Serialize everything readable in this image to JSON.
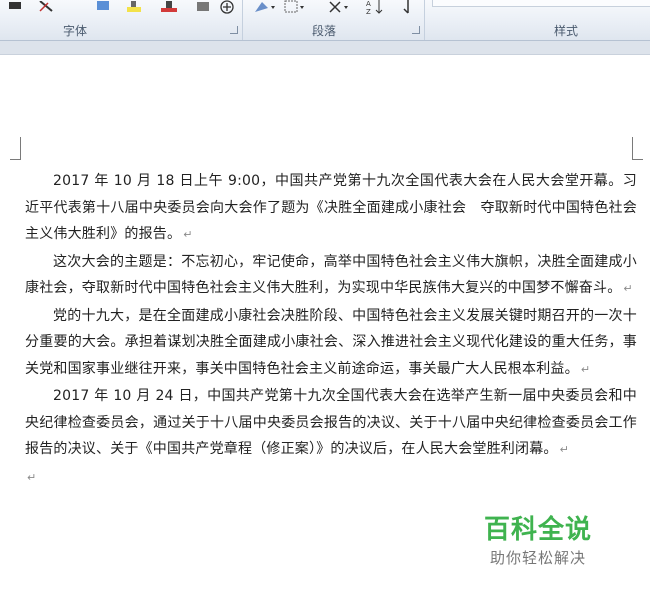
{
  "ribbon": {
    "groups": [
      {
        "label": "字体"
      },
      {
        "label": "段落"
      },
      {
        "label": "样式"
      }
    ]
  },
  "document": {
    "paragraphs": [
      "2017 年 10 月 18 日上午 9:00，中国共产党第十九次全国代表大会在人民大会堂开幕。习近平代表第十八届中央委员会向大会作了题为《决胜全面建成小康社会　夺取新时代中国特色社会主义伟大胜利》的报告。",
      "这次大会的主题是：不忘初心，牢记使命，高举中国特色社会主义伟大旗帜，决胜全面建成小康社会，夺取新时代中国特色社会主义伟大胜利，为实现中华民族伟大复兴的中国梦不懈奋斗。",
      "党的十九大，是在全面建成小康社会决胜阶段、中国特色社会主义发展关键时期召开的一次十分重要的大会。承担着谋划决胜全面建成小康社会、深入推进社会主义现代化建设的重大任务，事关党和国家事业继往开来，事关中国特色社会主义前途命运，事关最广大人民根本利益。",
      "2017 年 10 月 24 日，中国共产党第十九次全国代表大会在选举产生新一届中央委员会和中央纪律检查委员会，通过关于十八届中央委员会报告的决议、关于十八届中央纪律检查委员会工作报告的决议、关于《中国共产党章程（修正案）》的决议后，在人民大会堂胜利闭幕。"
    ],
    "paragraph_mark": "↵"
  },
  "watermark": {
    "title": "百科全说",
    "subtitle": "助你轻松解决"
  }
}
